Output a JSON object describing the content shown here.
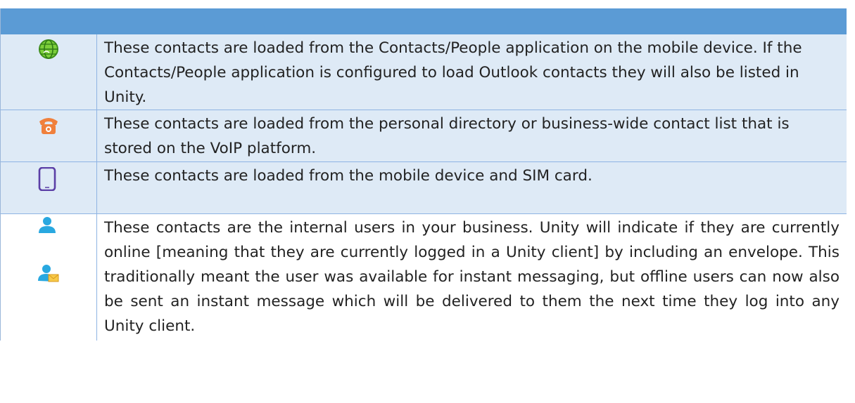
{
  "colors": {
    "header": "#5b9bd5",
    "row_shade": "#deeaf6",
    "border": "#8eb4e3",
    "text": "#222222"
  },
  "rows": [
    {
      "icon": "globe-icon",
      "text": "These contacts are loaded from the Contacts/People application on the mobile device. If the Contacts/People application is configured to load Outlook contacts they will also be listed in Unity."
    },
    {
      "icon": "phone-icon",
      "text": "These contacts are loaded from the personal directory or business-wide contact list that is stored on the VoIP platform."
    },
    {
      "icon": "mobile-device-icon",
      "text": "These contacts are loaded from the mobile device and SIM card."
    },
    {
      "icon": "user-icon",
      "icon_secondary": "user-envelope-icon",
      "text": "These contacts are the internal users in your business. Unity will indicate if they are currently online [meaning that they are currently logged in a Unity client] by including an envelope. This traditionally meant the user was available for instant messaging, but offline users can now also be sent an instant message which will be delivered to them the next time they log into any Unity client."
    }
  ]
}
